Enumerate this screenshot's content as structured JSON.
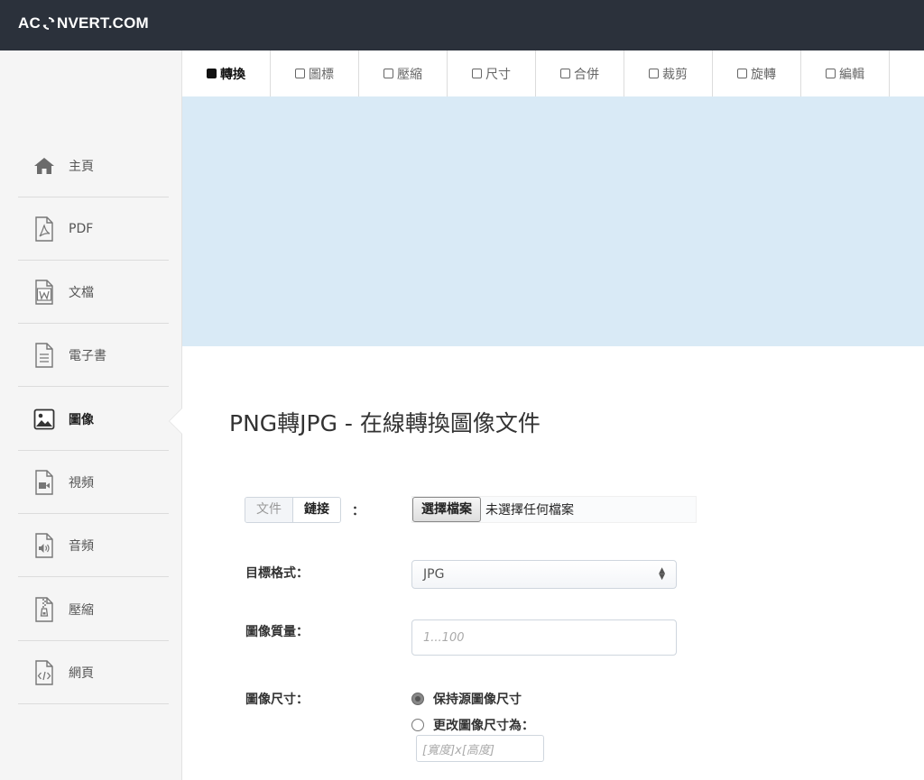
{
  "header": {
    "logo_left": "AC",
    "logo_right": "NVERT.COM"
  },
  "sidebar": {
    "items": [
      {
        "label": "主頁",
        "icon": "home-icon"
      },
      {
        "label": "PDF",
        "icon": "pdf-file-icon"
      },
      {
        "label": "文檔",
        "icon": "word-file-icon"
      },
      {
        "label": "電子書",
        "icon": "ebook-file-icon"
      },
      {
        "label": "圖像",
        "icon": "image-file-icon",
        "active": true
      },
      {
        "label": "視頻",
        "icon": "video-file-icon"
      },
      {
        "label": "音頻",
        "icon": "audio-file-icon"
      },
      {
        "label": "壓縮",
        "icon": "archive-file-icon"
      },
      {
        "label": "網頁",
        "icon": "code-file-icon"
      }
    ]
  },
  "tabs": [
    {
      "label": "轉換",
      "active": true
    },
    {
      "label": "圖標"
    },
    {
      "label": "壓縮"
    },
    {
      "label": "尺寸"
    },
    {
      "label": "合併"
    },
    {
      "label": "裁剪"
    },
    {
      "label": "旋轉"
    },
    {
      "label": "編輯"
    }
  ],
  "main": {
    "title": "PNG轉JPG - 在線轉換圖像文件",
    "source_toggle": {
      "file": "文件",
      "link": "鏈接",
      "colon": "："
    },
    "file_input": {
      "button": "選擇檔案",
      "status": "未選擇任何檔案"
    },
    "target_format": {
      "label": "目標格式：",
      "value": "JPG"
    },
    "quality": {
      "label": "圖像質量：",
      "placeholder": "1...100"
    },
    "size": {
      "label": "圖像尺寸：",
      "option_keep": "保持源圖像尺寸",
      "option_change": "更改圖像尺寸為：",
      "dims_placeholder": "[寬度]x[高度]"
    }
  },
  "colors": {
    "topbar": "#2b313b",
    "banner": "#d9eaf6",
    "sidebar": "#f5f5f5"
  }
}
